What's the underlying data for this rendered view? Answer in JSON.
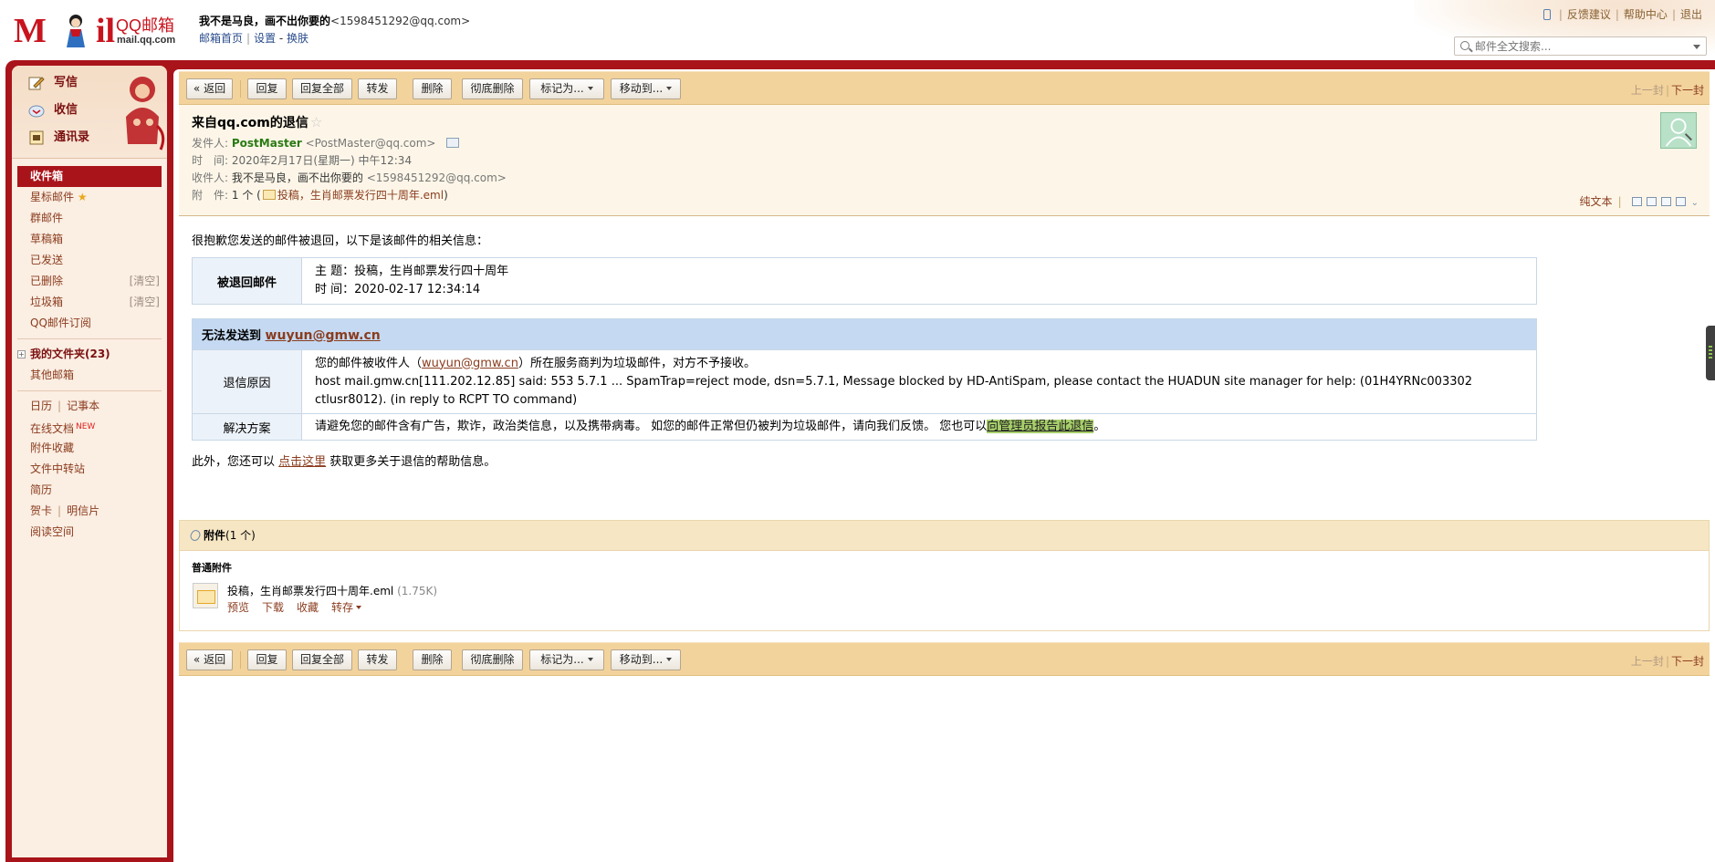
{
  "brand": {
    "logo_m": "M",
    "logo_il": "il",
    "name": "QQ邮箱",
    "domain": "mail.qq.com"
  },
  "user": {
    "name": "我不是马良，画不出你要的",
    "email": "<1598451292@qq.com>"
  },
  "user_links": {
    "home": "邮箱首页",
    "settings": "设置",
    "dash": " - ",
    "skin": "换肤"
  },
  "top_links": {
    "feedback": "反馈建议",
    "help": "帮助中心",
    "logout": "退出"
  },
  "search": {
    "placeholder": "邮件全文搜索..."
  },
  "sidebar": {
    "compose": "写信",
    "inbox_action": "收信",
    "contacts": "通讯录",
    "folders": [
      {
        "label": "收件箱"
      },
      {
        "label": "星标邮件"
      },
      {
        "label": "群邮件"
      },
      {
        "label": "草稿箱"
      },
      {
        "label": "已发送"
      },
      {
        "label": "已删除",
        "clear": "[清空]"
      },
      {
        "label": "垃圾箱",
        "clear": "[清空]"
      },
      {
        "label": "QQ邮件订阅"
      }
    ],
    "myfolders": "我的文件夹(23)",
    "other_mail": "其他邮箱",
    "tools": {
      "calendar": "日历",
      "notes": "记事本",
      "docs": "在线文档",
      "docs_badge": "NEW",
      "fav_attach": "附件收藏",
      "transfer": "文件中转站",
      "resume": "简历",
      "card": "贺卡",
      "postcard": "明信片",
      "reading": "阅读空间"
    }
  },
  "toolbar": {
    "back": "« 返回",
    "reply": "回复",
    "reply_all": "回复全部",
    "forward": "转发",
    "delete": "删除",
    "delete_perm": "彻底删除",
    "mark_as": "标记为...",
    "move_to": "移动到...",
    "prev": "上一封",
    "next": "下一封"
  },
  "mail": {
    "subject": "来自qq.com的退信",
    "star": "☆",
    "from_label": "发件人:",
    "from_name": "PostMaster",
    "from_addr": "<PostMaster@qq.com>",
    "time_label": "时　间:",
    "time": "2020年2月17日(星期一) 中午12:34",
    "to_label": "收件人:",
    "to_name": "我不是马良，画不出你要的",
    "to_addr": "<1598451292@qq.com>",
    "att_label": "附　件:",
    "att_count": "1 个 (",
    "att_name": "投稿，生肖邮票发行四十周年.eml",
    "att_close": ")",
    "plain_text": "纯文本"
  },
  "body": {
    "intro": "很抱歉您发送的邮件被退回，以下是该邮件的相关信息：",
    "bounced_label": "被退回邮件",
    "subject_line": "主 题：投稿，生肖邮票发行四十周年",
    "time_line": "时 间：2020-02-17 12:34:14",
    "cannot_deliver": "无法发送到",
    "recipient": "wuyun@gmw.cn",
    "reason_label": "退信原因",
    "reason_pre": "您的邮件被收件人（",
    "reason_link": "wuyun@gmw.cn",
    "reason_post": "）所在服务商判为垃圾邮件，对方不予接收。",
    "reason_detail": "host mail.gmw.cn[111.202.12.85] said: 553 5.7.1 ... SpamTrap=reject mode, dsn=5.7.1, Message blocked by HD-AntiSpam, please contact the HUADUN site manager for help: (01H4YRNc003302 ctlusr8012). (in reply to RCPT TO command)",
    "solution_label": "解决方案",
    "solution_text": "请避免您的邮件含有广告，欺诈，政治类信息，以及携带病毒。 如您的邮件正常但仍被判为垃圾邮件，请向我们反馈。 您也可以",
    "solution_link": "向管理员报告此退信",
    "solution_end": "。",
    "more_pre": "此外，您还可以 ",
    "more_link": "点击这里",
    "more_post": " 获取更多关于退信的帮助信息。"
  },
  "attachments": {
    "title": "附件",
    "count": "(1 个)",
    "type": "普通附件",
    "file_name": "投稿，生肖邮票发行四十周年.eml",
    "file_size": "(1.75K)",
    "preview": "预览",
    "download": "下载",
    "favorite": "收藏",
    "save_to": "转存"
  },
  "colors": {
    "frame": "#a9141a",
    "toolbar": "#f3d39c",
    "link": "#8a3c1e",
    "sender": "#2a7a14"
  }
}
